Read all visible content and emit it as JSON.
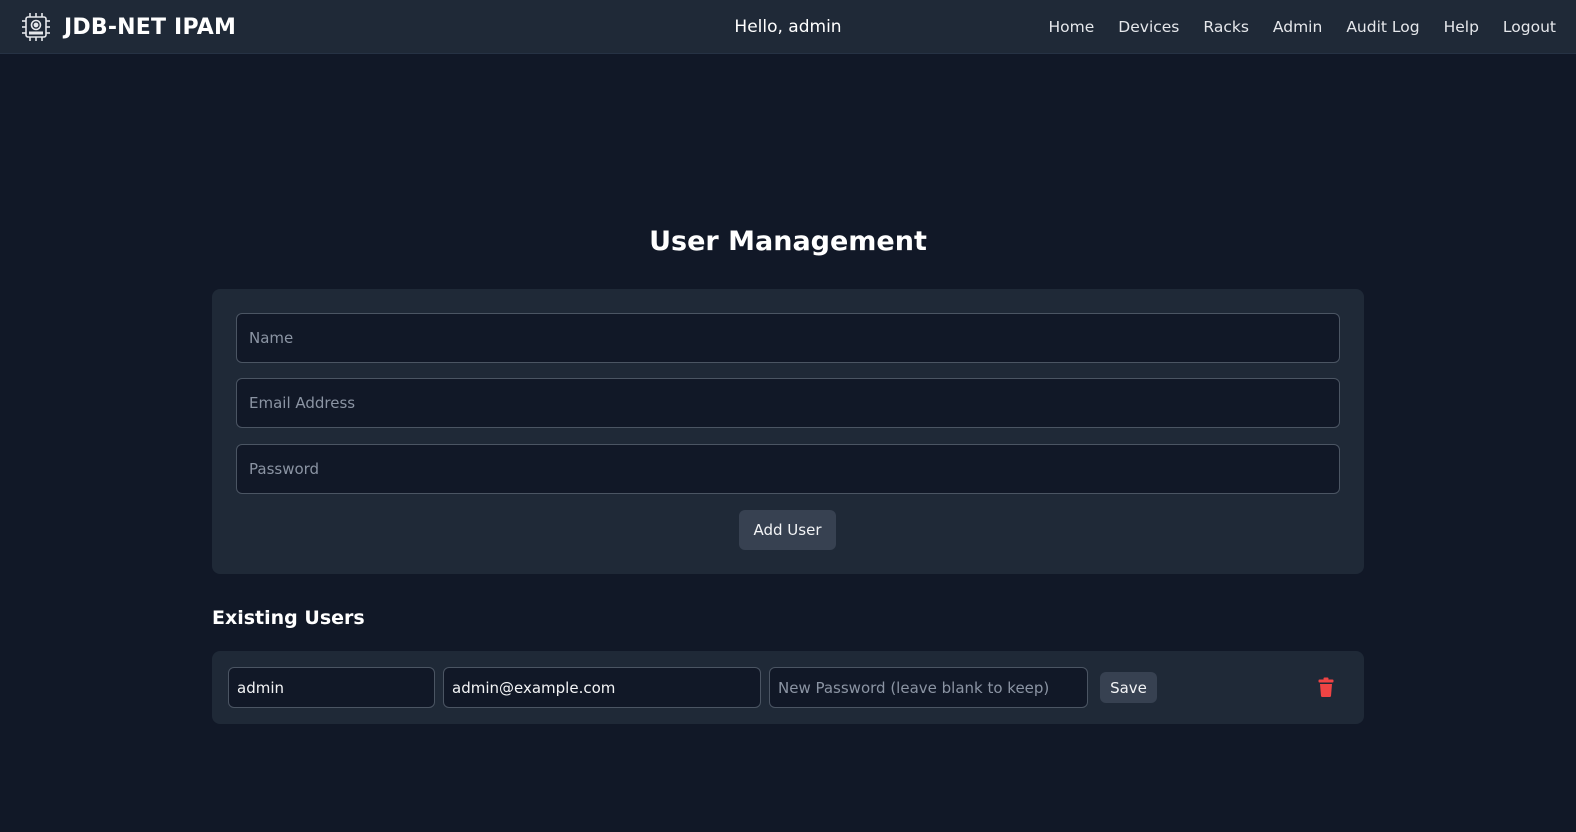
{
  "header": {
    "logo_icon": "gear-chip-logo-icon",
    "brand": "JDB-NET IPAM",
    "greeting": "Hello, admin",
    "nav": [
      "Home",
      "Devices",
      "Racks",
      "Admin",
      "Audit Log",
      "Help",
      "Logout"
    ]
  },
  "main": {
    "title": "User Management",
    "form": {
      "name_placeholder": "Name",
      "email_placeholder": "Email Address",
      "password_placeholder": "Password",
      "add_label": "Add User"
    },
    "existing_title": "Existing Users",
    "users": [
      {
        "username": "admin",
        "email": "admin@example.com",
        "password_placeholder": "New Password (leave blank to keep)",
        "save_label": "Save",
        "delete_icon": "trash-icon"
      }
    ]
  },
  "colors": {
    "background": "#111827",
    "surface": "#1f2937",
    "button": "#374151",
    "danger": "#ef4444"
  }
}
